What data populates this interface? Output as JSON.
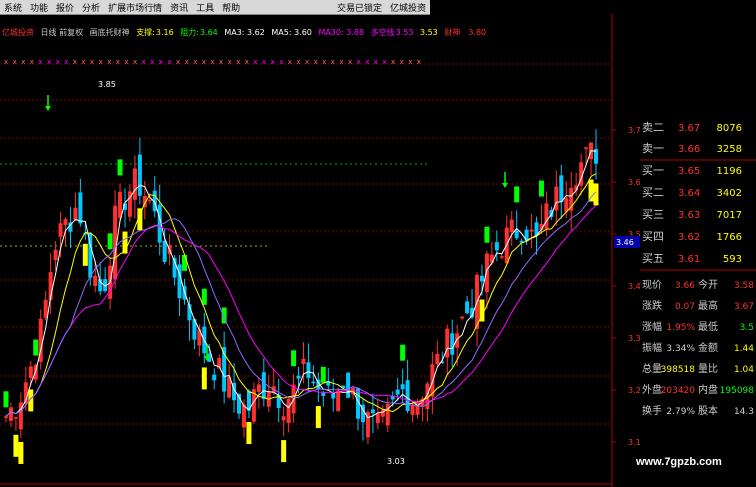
{
  "menu": {
    "items": [
      "系统",
      "功能",
      "报价",
      "分析",
      "扩展市场行情",
      "资讯",
      "工具",
      "帮助"
    ],
    "right_items": [
      "交易已锁定",
      "亿城投资"
    ]
  },
  "indicator": {
    "title": "亿城投资",
    "period": "日线 前复权",
    "name": "画底托财神",
    "support_label": "支撑:",
    "support_value": "3.16",
    "pressure_label": "阻力:",
    "pressure_value": "3.64",
    "ma3": "MA3: 3.62",
    "ma5": "MA5: 3.60",
    "ma30": "MA30: 3.88",
    "dk_label": "多空线",
    "dk_value": "3.53",
    "dk2": "3.53",
    "caishen_label": "财神",
    "caishen_value": "3.80"
  },
  "chart_data": {
    "type": "candlestick",
    "y_ticks": [
      "3.70",
      "3.60",
      "3.50",
      "3.40",
      "3.30",
      "3.20",
      "3.10"
    ],
    "current_price_tag": "3.46",
    "high_label": "3.85",
    "low_label": "3.03",
    "colors": {
      "up": "#ff3030",
      "down": "#00c8ff",
      "ma_white": "#ffffff",
      "ma_yellow": "#ffff00",
      "ma_magenta": "#ff00ff",
      "ma_purple": "#8a6cff",
      "signal_green": "#00ff00",
      "signal_yellow": "#ffff00"
    }
  },
  "quote": {
    "sell": [
      {
        "label": "卖二",
        "price": "3.67",
        "vol": "8076"
      },
      {
        "label": "卖一",
        "price": "3.66",
        "vol": "3258"
      }
    ],
    "buy": [
      {
        "label": "买一",
        "price": "3.65",
        "vol": "1196"
      },
      {
        "label": "买二",
        "price": "3.64",
        "vol": "3402"
      },
      {
        "label": "买三",
        "price": "3.63",
        "vol": "7017"
      },
      {
        "label": "买四",
        "price": "3.62",
        "vol": "1766"
      },
      {
        "label": "买五",
        "price": "3.61",
        "vol": "593"
      }
    ],
    "stats": [
      {
        "l1": "现价",
        "v1": "3.66",
        "l2": "今开",
        "v2": "3.58"
      },
      {
        "l1": "涨跌",
        "v1": "0.07",
        "l2": "最高",
        "v2": "3.67"
      },
      {
        "l1": "涨幅",
        "v1": "1.95%",
        "l2": "最低",
        "v2": "3.5"
      },
      {
        "l1": "振幅",
        "v1": "3.34%",
        "l2": "金额",
        "v2": "1.44"
      },
      {
        "l1": "总量",
        "v1": "398518",
        "l2": "量比",
        "v2": "1.04"
      },
      {
        "l1": "外盘",
        "v1": "203420",
        "l2": "内盘",
        "v2": "195098"
      },
      {
        "l1": "换手",
        "v1": "2.79%",
        "l2": "股本",
        "v2": "14.3"
      }
    ]
  },
  "watermark": "www.7gpzb.com"
}
